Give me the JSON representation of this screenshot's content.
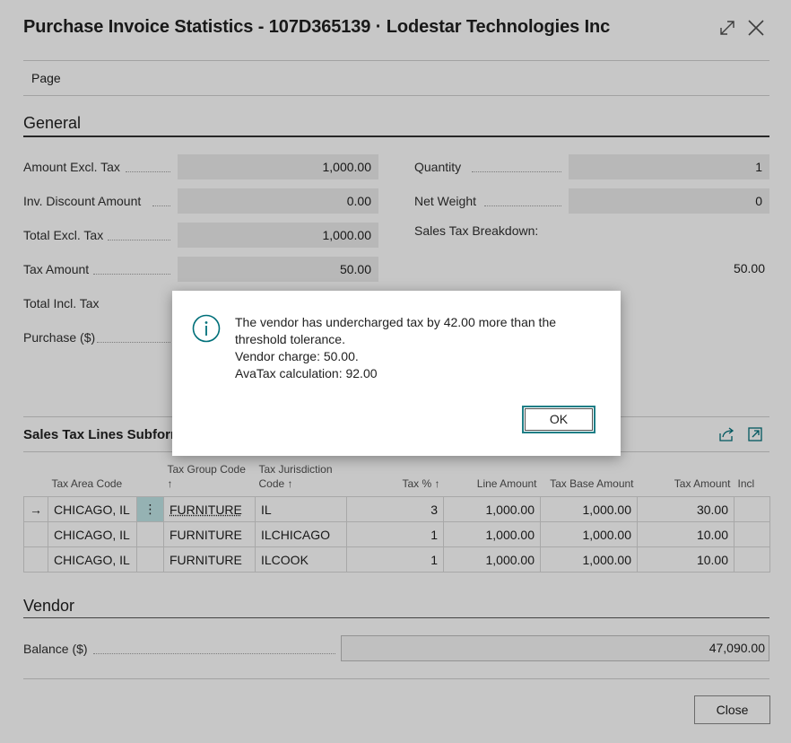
{
  "window": {
    "title": "Purchase Invoice Statistics - 107D365139 · Lodestar Technologies Inc",
    "expand_icon": "expand-icon",
    "close_icon": "close-icon"
  },
  "menu": {
    "page_label": "Page"
  },
  "general": {
    "title": "General",
    "left_fields": [
      {
        "label": "Amount Excl. Tax",
        "value": "1,000.00"
      },
      {
        "label": "Inv. Discount Amount",
        "value": "0.00"
      },
      {
        "label": "Total Excl. Tax",
        "value": "1,000.00"
      },
      {
        "label": "Tax Amount",
        "value": "50.00"
      },
      {
        "label": "Total Incl. Tax",
        "value": ""
      },
      {
        "label": "Purchase ($)",
        "value": ""
      }
    ],
    "right_fields": [
      {
        "label": "Quantity",
        "value": "1"
      },
      {
        "label": "Net Weight",
        "value": "0"
      }
    ],
    "sales_tax_breakdown_label": "Sales Tax Breakdown:",
    "sales_tax_breakdown_value": "50.00"
  },
  "subform": {
    "title": "Sales Tax Lines Subform",
    "share_icon": "share-icon",
    "expand_icon": "open-in-new-window-icon",
    "columns": [
      "Tax Area Code",
      "",
      "Tax Group Code ↑",
      "Tax Jurisdiction Code ↑",
      "Tax % ↑",
      "Line Amount",
      "Tax Base Amount",
      "Tax Amount",
      "Incl"
    ],
    "rows": [
      {
        "marker": "→",
        "tax_area": "CHICAGO, IL",
        "group": "FURNITURE",
        "jurisdiction": "IL",
        "pct": "3",
        "line_amount": "1,000.00",
        "base": "1,000.00",
        "tax": "30.00"
      },
      {
        "marker": "",
        "tax_area": "CHICAGO, IL",
        "group": "FURNITURE",
        "jurisdiction": "ILCHICAGO",
        "pct": "1",
        "line_amount": "1,000.00",
        "base": "1,000.00",
        "tax": "10.00"
      },
      {
        "marker": "",
        "tax_area": "CHICAGO, IL",
        "group": "FURNITURE",
        "jurisdiction": "ILCOOK",
        "pct": "1",
        "line_amount": "1,000.00",
        "base": "1,000.00",
        "tax": "10.00"
      }
    ],
    "row_menu_glyph": "⋮"
  },
  "vendor": {
    "title": "Vendor",
    "balance_label": "Balance ($)",
    "balance_value": "47,090.00"
  },
  "footer": {
    "close_label": "Close"
  },
  "dialog": {
    "icon": "info-icon",
    "line1": "The vendor has undercharged tax by 42.00 more than the",
    "line2": "threshold tolerance.",
    "line3": "Vendor charge: 50.00.",
    "line4": "AvaTax calculation: 92.00",
    "ok_label": "OK"
  },
  "colors": {
    "accent": "#00707a",
    "selected_cell": "#bfe4e6",
    "field_background": "#ececec"
  }
}
